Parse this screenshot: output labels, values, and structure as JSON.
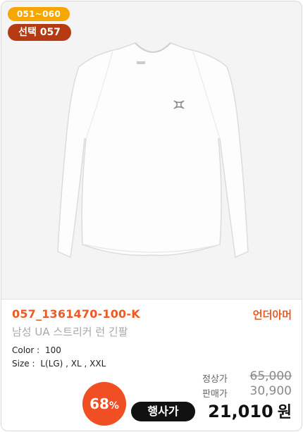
{
  "badges": {
    "range": "051~060",
    "selection": "선택 057"
  },
  "product": {
    "code": "057_1361470-100-K",
    "brand": "언더아머",
    "name": "남성 UA 스트리커 런 긴팔",
    "color_label": "Color :",
    "color_value": "100",
    "size_label": "Size :",
    "size_value": "L(LG) , XL , XXL"
  },
  "pricing": {
    "discount_value": "68",
    "discount_unit": "%",
    "original_label": "정상가",
    "original_price": "65,000",
    "sale_label": "판매가",
    "sale_price": "30,900",
    "event_label": "행사가",
    "event_price": "21,010",
    "currency": "원"
  },
  "colors": {
    "accent_orange": "#f05a22",
    "range_badge": "#f7a600",
    "select_badge": "#b33a12",
    "event_pill": "#111111"
  },
  "icons": {
    "product_image": "white-long-sleeve-shirt",
    "logo": "under-armour-logo"
  }
}
